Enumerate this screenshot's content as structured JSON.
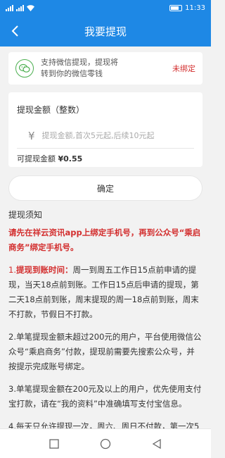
{
  "status_bar": {
    "left_icons": [
      "signal-icon",
      "signal-icon",
      "wifi-icon"
    ],
    "time": "11:33"
  },
  "header": {
    "title": "我要提现",
    "back_icon": "chevron-left-icon"
  },
  "wechat_card": {
    "icon": "wechat-icon",
    "line1": "支持微信提现，提现将",
    "line2": "转到你的微信零钱",
    "status": "未绑定",
    "status_color": "#d32f2f"
  },
  "amount_card": {
    "title": "提现金额（整数）",
    "currency_symbol": "¥",
    "placeholder": "提现金额,首次5元起,后续10元起",
    "input_value": "",
    "available_label": "可提现金额",
    "available_value": "¥0.55"
  },
  "confirm_button": {
    "label": "确定"
  },
  "notice": {
    "title": "提现须知",
    "intro": "请先在祥云资讯app上绑定手机号，再到公众号“乘启商务”绑定手机号。",
    "items": [
      {
        "prefix": "1.",
        "bold": "提现到账时间：",
        "text": "周一到周五工作日15点前申请的提现，当天18点前到账。工作日15点后申请的提现，第二天18点前到账，周末提现的周一18点前到账，周末不打款，节假日不打款。"
      },
      {
        "prefix": "",
        "bold": "",
        "text": "2.单笔提现金额未超过200元的用户，平台使用微信公众号“乘启商务”付款，提现前需要先搜索公众号，并按提示完成账号绑定。"
      },
      {
        "prefix": "",
        "bold": "",
        "text": "3.单笔提现金额在200元及以上的用户，优先使用支付宝打款，请在“我的资料”中准确填写支付宝信息。"
      },
      {
        "prefix": "",
        "bold": "",
        "text": "4.每天只允许提现一次，周六、周日不付款，第一次5"
      }
    ]
  },
  "colors": {
    "primary": "#1e88e5",
    "accent_red": "#d32f2f",
    "wechat_green": "#4caf50",
    "background": "#f2f2f2"
  },
  "system_nav": {
    "icons": [
      "square-icon",
      "circle-icon",
      "triangle-back-icon"
    ]
  }
}
